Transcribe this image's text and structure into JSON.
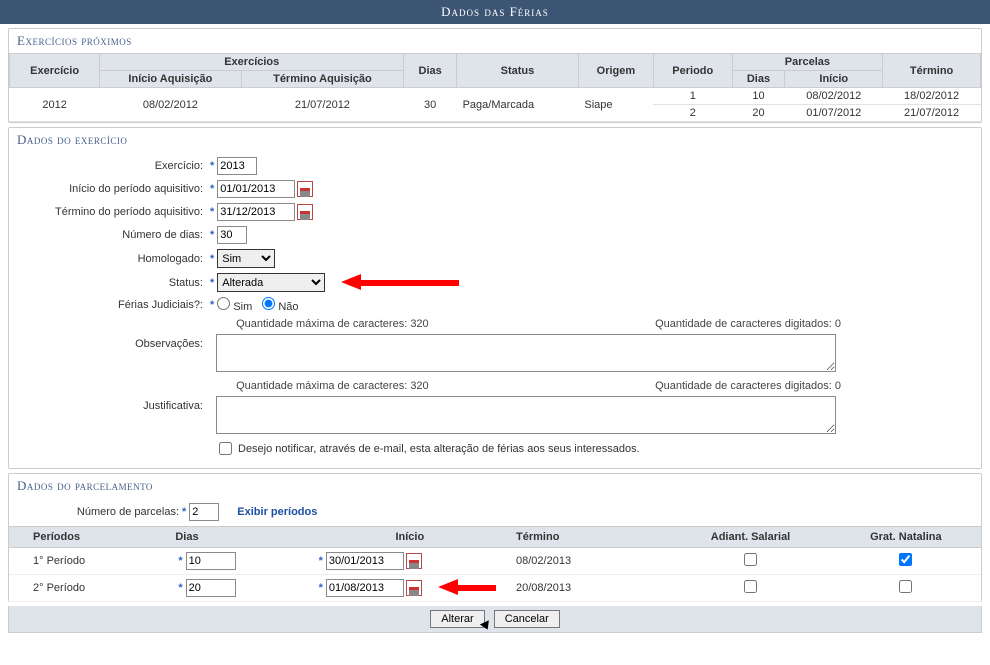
{
  "title": "Dados das Férias",
  "sections": {
    "proximos": "Exercícios próximos",
    "exercicio": "Dados do exercício",
    "parcelamento": "Dados do parcelamento"
  },
  "grid_proximos": {
    "headers": {
      "exercicios_group": "Exercícios",
      "parcelas_group": "Parcelas",
      "exercicio": "Exercício",
      "inicio_aq": "Início Aquisição",
      "termino_aq": "Término Aquisição",
      "dias": "Dias",
      "status": "Status",
      "origem": "Origem",
      "periodo": "Periodo",
      "p_dias": "Dias",
      "p_inicio": "Início",
      "p_termino": "Término"
    },
    "row": {
      "exercicio": "2012",
      "inicio_aq": "08/02/2012",
      "termino_aq": "21/07/2012",
      "dias": "30",
      "status": "Paga/Marcada",
      "origem": "Siape"
    },
    "parcelas": [
      {
        "periodo": "1",
        "dias": "10",
        "inicio": "08/02/2012",
        "termino": "18/02/2012"
      },
      {
        "periodo": "2",
        "dias": "20",
        "inicio": "01/07/2012",
        "termino": "21/07/2012"
      }
    ]
  },
  "form": {
    "labels": {
      "exercicio": "Exercício:",
      "inicio_periodo": "Início do período aquisitivo:",
      "termino_periodo": "Término do período aquisitivo:",
      "num_dias": "Número de dias:",
      "homologado": "Homologado:",
      "status": "Status:",
      "ferias_jud": "Férias Judiciais?:",
      "observacoes": "Observações:",
      "justificativa": "Justificativa:",
      "sim": "Sim",
      "nao": "Não",
      "max_chars": "Quantidade máxima de caracteres: 320",
      "typed_chars": "Quantidade de caracteres digitados: 0",
      "notificar": "Desejo notificar, através de e-mail, esta alteração de férias aos seus interessados."
    },
    "values": {
      "exercicio": "2013",
      "inicio_periodo": "01/01/2013",
      "termino_periodo": "31/12/2013",
      "num_dias": "30",
      "homologado": "Sim",
      "status": "Alterada"
    }
  },
  "parcelamento": {
    "num_parcelas_label": "Número de parcelas:",
    "num_parcelas": "2",
    "exibir": "Exibir períodos",
    "headers": {
      "periodos": "Períodos",
      "dias": "Dias",
      "inicio": "Início",
      "termino": "Término",
      "adiant": "Adiant. Salarial",
      "grat": "Grat. Natalina"
    },
    "rows": [
      {
        "periodo": "1° Período",
        "dias": "10",
        "inicio": "30/01/2013",
        "termino": "08/02/2013",
        "adiant": false,
        "grat": true
      },
      {
        "periodo": "2° Período",
        "dias": "20",
        "inicio": "01/08/2013",
        "termino": "20/08/2013",
        "adiant": false,
        "grat": false
      }
    ]
  },
  "buttons": {
    "alterar": "Alterar",
    "cancelar": "Cancelar"
  }
}
